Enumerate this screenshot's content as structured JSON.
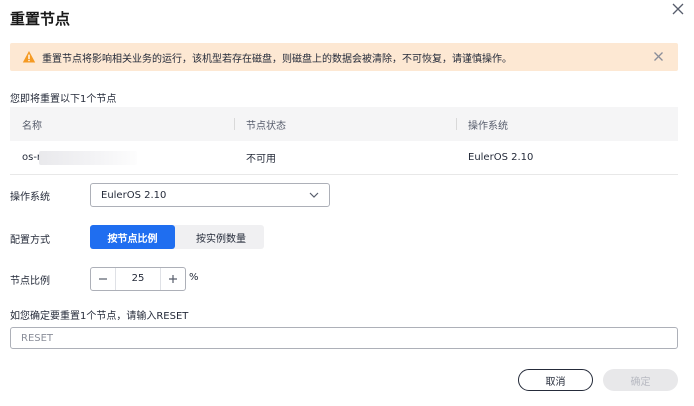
{
  "dialog": {
    "title": "重置节点"
  },
  "alert": {
    "message": "重置节点将影响相关业务的运行，该机型若存在磁盘，则磁盘上的数据会被清除，不可恢复，请谨慎操作。",
    "color": "#fde8d3",
    "icon": "warning-icon"
  },
  "intro": "您即将重置以下1个节点",
  "table": {
    "headers": [
      "名称",
      "节点状态",
      "操作系统"
    ],
    "rows": [
      {
        "name": "os-r",
        "status": "不可用",
        "os": "EulerOS 2.10"
      }
    ]
  },
  "form": {
    "os_label": "操作系统",
    "os_value": "EulerOS 2.10",
    "config_label": "配置方式",
    "config_options": [
      "按节点比例",
      "按实例数量"
    ],
    "config_selected": "按节点比例",
    "ratio_label": "节点比例",
    "ratio_value": "25",
    "ratio_unit": "%",
    "confirm_label": "如您确定要重置1个节点，请输入RESET",
    "confirm_placeholder": "RESET"
  },
  "buttons": {
    "cancel": "取消",
    "ok": "确定"
  },
  "colors": {
    "primary": "#1f6ef0",
    "warning": "#f59a23"
  }
}
